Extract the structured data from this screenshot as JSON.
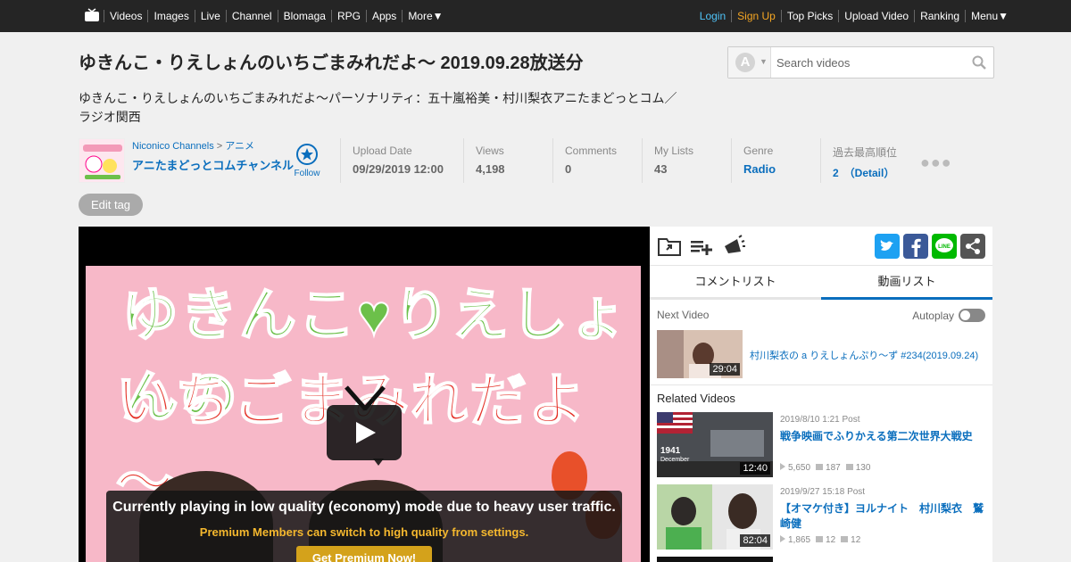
{
  "topbar": {
    "nav_left": [
      "Videos",
      "Images",
      "Live",
      "Channel",
      "Blomaga",
      "RPG",
      "Apps",
      "More▼"
    ],
    "login": "Login",
    "signup": "Sign Up",
    "nav_right": [
      "Top Picks",
      "Upload Video",
      "Ranking",
      "Menu▼"
    ]
  },
  "video": {
    "title": "ゆきんこ・りえしょんのいちごまみれだよ～ 2019.09.28放送分",
    "description": "ゆきんこ・りえしょんのいちごまみれだよ～パーソナリティ：五十嵐裕美・村川梨衣アニたまどっとコム／ラジオ関西"
  },
  "search": {
    "placeholder": "Search videos",
    "filter_letter": "A"
  },
  "owner": {
    "category_root": "Niconico Channels",
    "separator": ">",
    "category": "アニメ",
    "name": "アニたまどっとコムチャンネル",
    "follow_label": "Follow"
  },
  "stats": [
    {
      "label": "Upload Date",
      "value": "09/29/2019 12:00"
    },
    {
      "label": "Views",
      "value": "4,198"
    },
    {
      "label": "Comments",
      "value": "0"
    },
    {
      "label": "My Lists",
      "value": "43"
    },
    {
      "label": "Genre",
      "value": "Radio"
    },
    {
      "label": "過去最高順位",
      "value": "2　（Detail）"
    }
  ],
  "edit_tag_label": "Edit tag",
  "player": {
    "thumb_line1": "ゆきんこ♥りえしょんの",
    "thumb_line2": "いちごまみれだよ～",
    "notice_main": "Currently playing in low quality (economy) mode due to heavy user traffic.",
    "notice_sub": "Premium Members can switch to high quality from settings.",
    "premium_button": "Get Premium Now!"
  },
  "panel": {
    "tabs": [
      "コメントリスト",
      "動画リスト"
    ],
    "active_tab": 1,
    "next_label": "Next Video",
    "autoplay_label": "Autoplay",
    "next_video": {
      "title": "村川梨衣の a りえしょんぷり～ず #234(2019.09.24)",
      "duration": "29:04"
    },
    "related_label": "Related Videos",
    "related": [
      {
        "date": "2019/8/10 1:21 Post",
        "title": "戦争映画でふりかえる第二次世界大戦史",
        "duration": "12:40",
        "views": "5,650",
        "comments": "187",
        "mylists": "130",
        "thumb_year": "1941",
        "thumb_month": "December"
      },
      {
        "date": "2019/9/27 15:18 Post",
        "title": "【オマケ付き】ヨルナイト　村川梨衣　鷲崎健",
        "duration": "82:04",
        "views": "1,865",
        "comments": "12",
        "mylists": "12"
      }
    ]
  },
  "colors": {
    "link": "#0a6ebd",
    "topbar": "#252525",
    "login": "#4fc3f7",
    "signup": "#f5a623",
    "twitter": "#1da1f2",
    "facebook": "#3b5998",
    "line": "#00b900",
    "share": "#555555"
  }
}
